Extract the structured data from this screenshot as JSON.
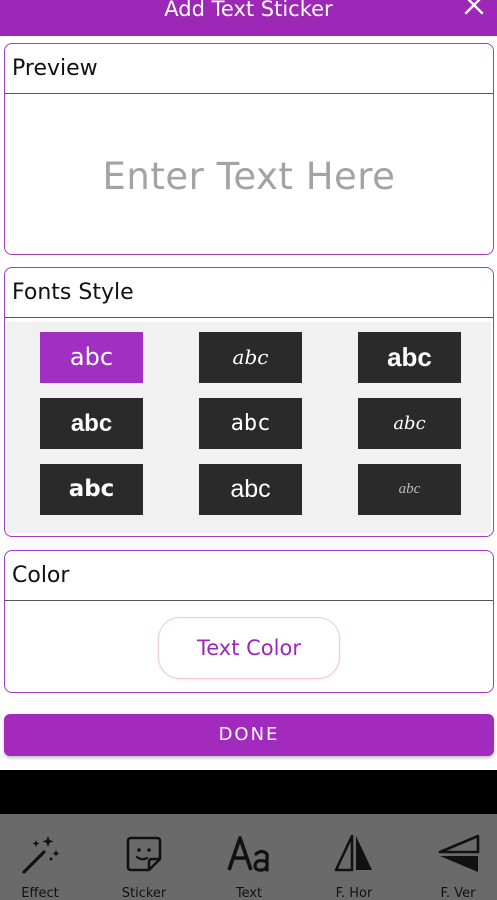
{
  "header": {
    "title": "Add Text Sticker",
    "close_icon": "close-icon"
  },
  "preview": {
    "heading": "Preview",
    "placeholder": "Enter Text Here"
  },
  "fonts": {
    "heading": "Fonts Style",
    "selected_index": 0,
    "tiles": [
      "abc",
      "abc",
      "abc",
      "abc",
      "abc",
      "abc",
      "abc",
      "abc",
      "abc"
    ]
  },
  "color": {
    "heading": "Color",
    "button_label": "Text Color"
  },
  "done": {
    "label": "DONE"
  },
  "bottom_nav": {
    "items": [
      {
        "label": "Effect",
        "icon": "magic-wand-icon"
      },
      {
        "label": "Sticker",
        "icon": "sticker-icon"
      },
      {
        "label": "Text",
        "icon": "text-aa-icon"
      },
      {
        "label": "F. Hor",
        "icon": "flip-horizontal-icon"
      },
      {
        "label": "F. Ver",
        "icon": "flip-vertical-icon"
      }
    ]
  },
  "colors": {
    "accent": "#9d27b7",
    "tile": "#2a2a2a",
    "tile_selected": "#a12fc1"
  }
}
